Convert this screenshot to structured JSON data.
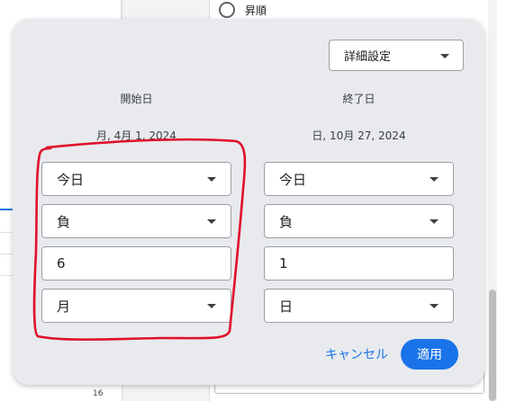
{
  "background": {
    "sort_option_label": "昇順",
    "row_number": "16"
  },
  "dialog": {
    "advanced_setting": {
      "value": "詳細設定"
    },
    "start": {
      "header": "開始日",
      "date_text": "月, 4月 1, 2024",
      "reference": "今日",
      "direction": "負",
      "amount": "6",
      "unit": "月"
    },
    "end": {
      "header": "終了日",
      "date_text": "日, 10月 27, 2024",
      "reference": "今日",
      "direction": "負",
      "amount": "1",
      "unit": "日"
    },
    "cancel_label": "キャンセル",
    "apply_label": "適用"
  },
  "colors": {
    "accent": "#1a73e8",
    "dialog_bg": "#e8eaed",
    "annotation": "#e0102a"
  },
  "icons": {
    "dropdown": "caret-down-icon",
    "radio": "radio-button-icon"
  }
}
